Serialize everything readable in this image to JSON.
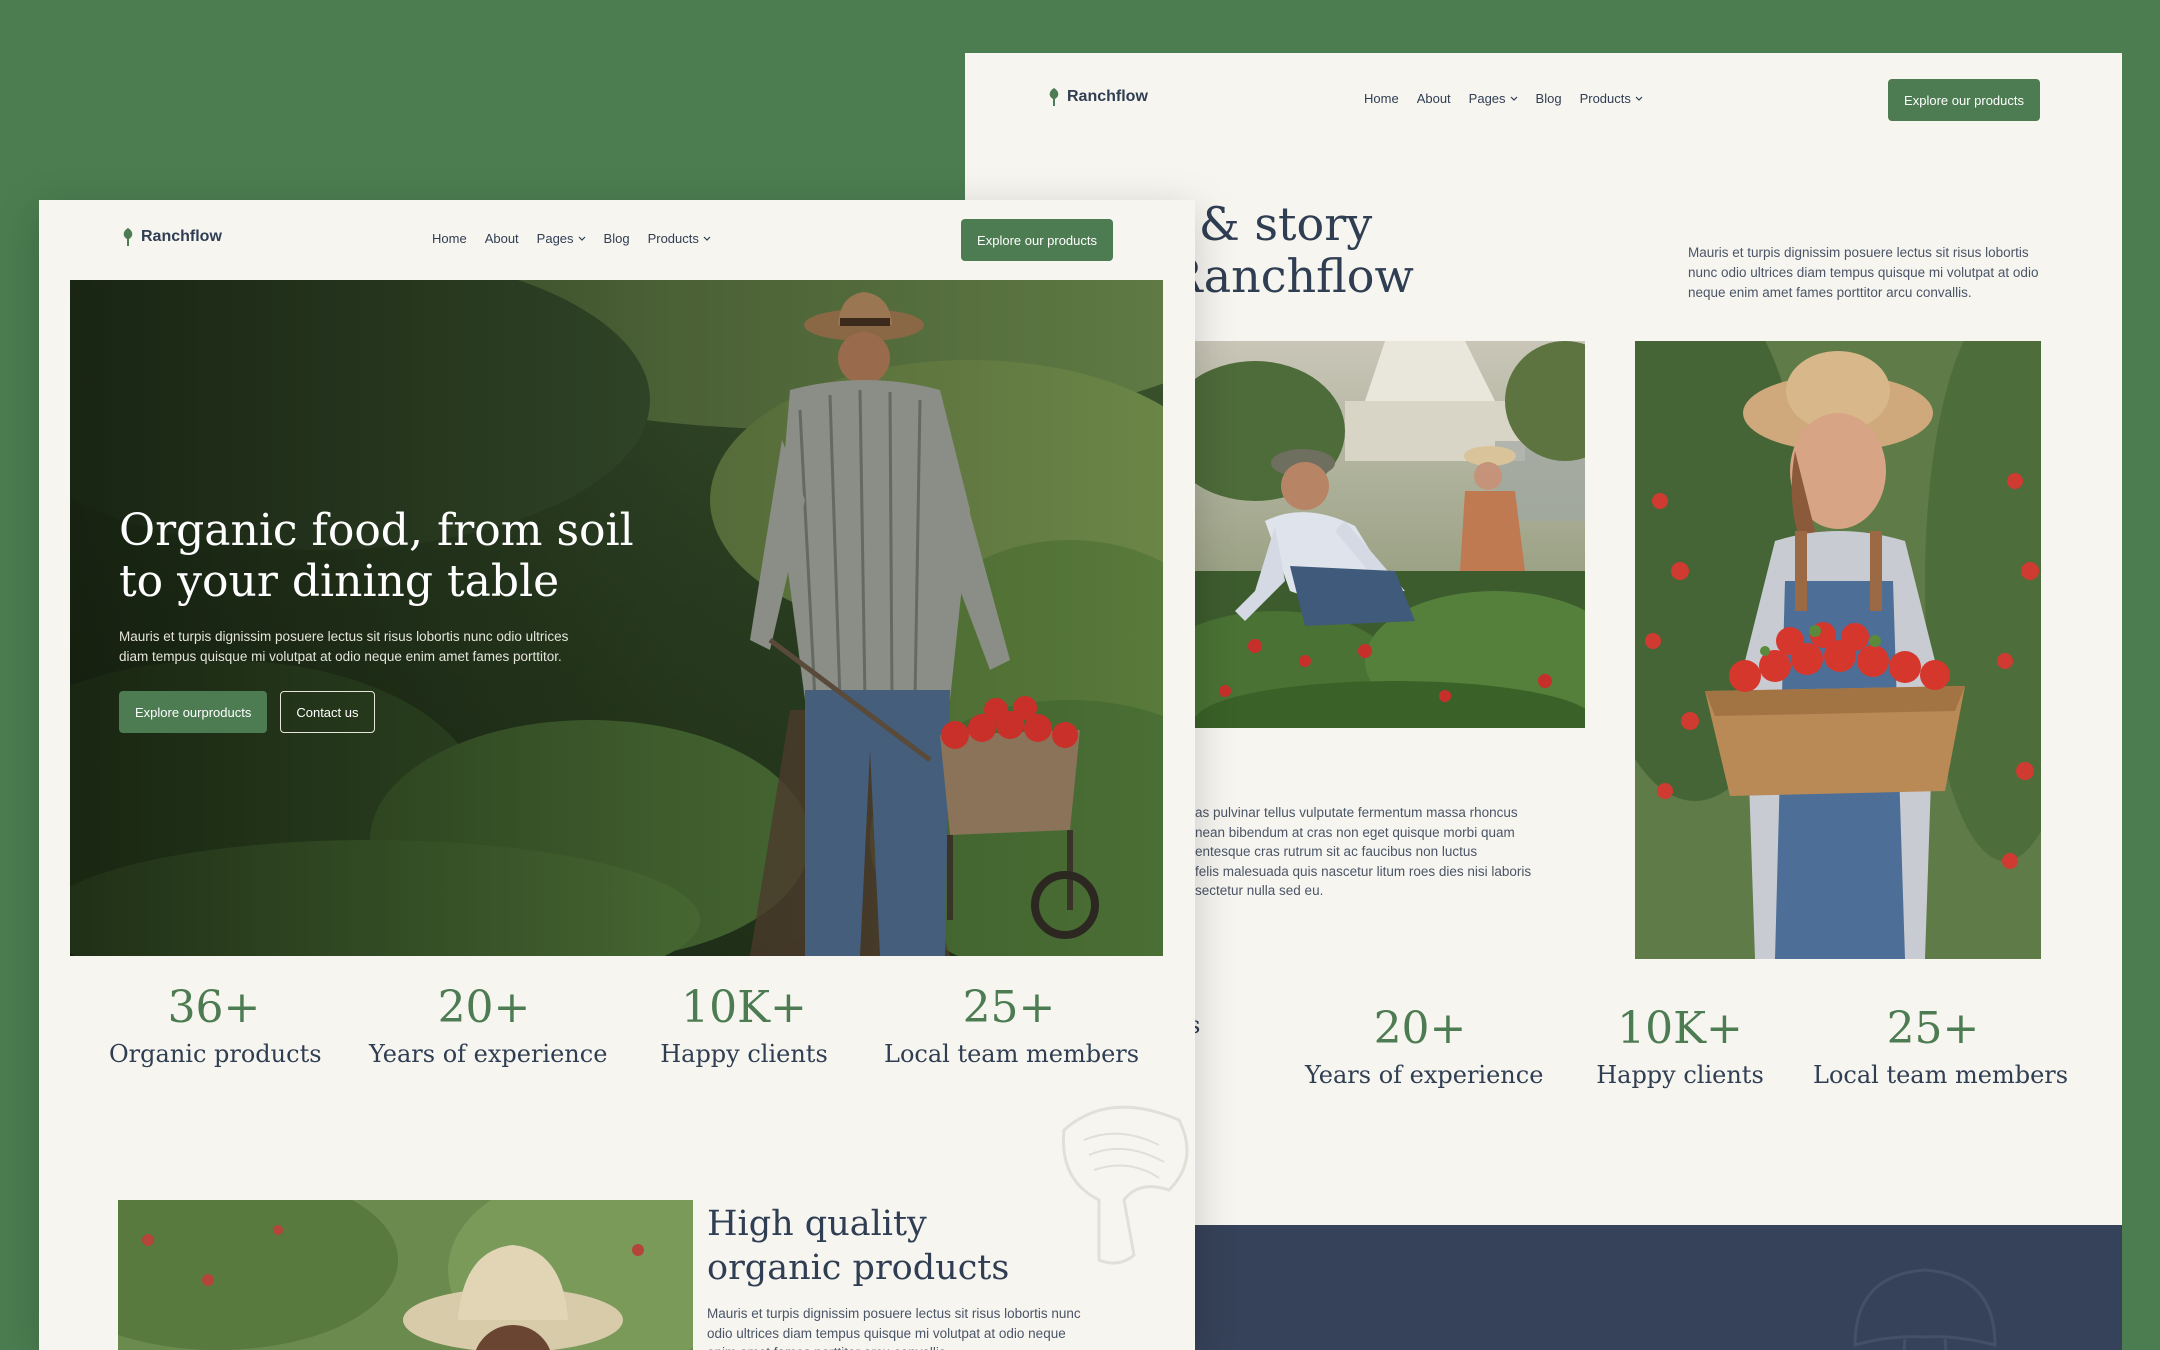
{
  "colors": {
    "background": "#4b7d50",
    "page": "#f7f5f0",
    "accent": "#4d7c52",
    "heading": "#2f3e52",
    "dark_band": "#364259"
  },
  "back": {
    "nav": {
      "brand": "Ranchflow",
      "links": [
        {
          "label": "Home"
        },
        {
          "label": "About"
        },
        {
          "label": "Pages",
          "has_dropdown": true
        },
        {
          "label": "Blog"
        },
        {
          "label": "Products",
          "has_dropdown": true
        }
      ],
      "cta": "Explore our products"
    },
    "story_title_line1": "ssion & story",
    "story_title_line2": "Ranchflow",
    "story_desc": "Mauris et turpis dignissim posuere lectus sit risus lobortis nunc odio ultrices diam tempus quisque mi volutpat at odio neque enim amet fames porttitor arcu convallis.",
    "story_body": [
      "as pulvinar tellus vulputate fermentum massa rhoncus",
      "nean bibendum at cras non eget quisque morbi quam",
      "entesque cras rutrum sit ac faucibus non luctus",
      "felis malesuada quis nascetur litum roes dies nisi laboris",
      "sectetur nulla sed eu."
    ],
    "stats": [
      {
        "num": "",
        "label": "cts"
      },
      {
        "num": "20+",
        "label": "Years of experience"
      },
      {
        "num": "10K+",
        "label": "Happy clients"
      },
      {
        "num": "25+",
        "label": "Local team members"
      }
    ]
  },
  "front": {
    "nav": {
      "brand": "Ranchflow",
      "links": [
        {
          "label": "Home"
        },
        {
          "label": "About"
        },
        {
          "label": "Pages",
          "has_dropdown": true
        },
        {
          "label": "Blog"
        },
        {
          "label": "Products",
          "has_dropdown": true
        }
      ],
      "cta": "Explore our products"
    },
    "hero": {
      "title_line1": "Organic food, from soil",
      "title_line2": "to your dining table",
      "desc": "Mauris et turpis dignissim posuere lectus sit risus lobortis nunc odio ultrices diam tempus quisque mi volutpat at odio neque enim amet fames porttitor.",
      "primary_btn": "Explore ourproducts",
      "secondary_btn": "Contact us"
    },
    "stats": [
      {
        "num": "36+",
        "label": "Organic products"
      },
      {
        "num": "20+",
        "label": "Years of experience"
      },
      {
        "num": "10K+",
        "label": "Happy clients"
      },
      {
        "num": "25+",
        "label": "Local team members"
      }
    ],
    "quality": {
      "title_line1": "High quality",
      "title_line2": "organic products",
      "desc": "Mauris et turpis dignissim posuere lectus sit risus lobortis nunc odio ultrices diam tempus quisque mi volutpat at odio neque enim amet fames porttitor arcu convallis."
    }
  }
}
